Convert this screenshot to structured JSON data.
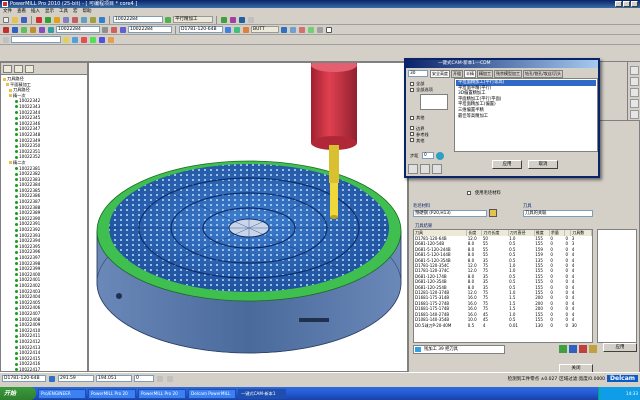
{
  "window": {
    "title": "PowerMILL Pro 2010 (25-bit) - [ 可编程项目 * core4 ]"
  },
  "menu": [
    "文件",
    "查看",
    "插入",
    "显示",
    "工具",
    "宏",
    "帮助"
  ],
  "toolbar": {
    "toolpath_select": "10022284",
    "strategy_label": "平行精加工",
    "tool_select": "10022284",
    "tool2_select": "10022284",
    "tool3_select": "D1781-120-64B",
    "boundary_label": "BUTT"
  },
  "explorer": {
    "items": [
      "刀具路径",
      "平面精加工",
      "刀具路径",
      "精一次",
      "10022342",
      "10022343",
      "10022344",
      "10022345",
      "10022346",
      "10022347",
      "10022348",
      "10022349",
      "10022350",
      "10022351",
      "10022352",
      "精二次",
      "10022381",
      "10022382",
      "10022383",
      "10022384",
      "10022385",
      "10022386",
      "10022387",
      "10022388",
      "10022389",
      "10022390",
      "10022391",
      "10022392",
      "10022393",
      "10022394",
      "10022395",
      "10022396",
      "10022397",
      "10022398",
      "10022399",
      "10022400",
      "10022401",
      "10022402",
      "10022403",
      "10022404",
      "10022405",
      "10022406",
      "10022407",
      "10022408",
      "10022409",
      "10022410",
      "10022411",
      "10022412",
      "10022413",
      "10022414",
      "10022415",
      "10022416",
      "10022417",
      "10022418",
      "10022419",
      "10022420",
      "10022421",
      "10022422"
    ]
  },
  "popup": {
    "title": "一键式CAM-新本1---CDM",
    "tabs": [
      "安全高度",
      "开粗",
      "半精",
      "精加工",
      "残余模型加工",
      "钻孔/铣孔/攻丝/沉头"
    ],
    "field_value": "30",
    "list": [
      "平坦面精加工(平行等高)",
      "平坦面半精(平行)",
      "3D偏置精加工",
      "平面精加工(平行/平面)",
      "平坦面精加工(偏置)",
      "三维偏置半精",
      "最佳等高精加工"
    ],
    "checks": [
      "全部",
      "全部选项",
      "其他"
    ],
    "options": [
      "边界",
      "参考线",
      "其他"
    ],
    "spin_label": "步距",
    "spin_value": "0",
    "btn_apply": "应用",
    "btn_cancel": "取消"
  },
  "dialog": {
    "cb_label": "使用毛坯材料",
    "material_label": "毛坯材料",
    "material_value": "预硬钢 (P20,H13)",
    "tool_label": "刀具",
    "tool_value": "刀具的关联",
    "table_title": "刀具结果",
    "columns": [
      "刀具",
      "长度",
      "刀刃长度",
      "刀刃直径",
      "锥度",
      "余量",
      "",
      "刀具数"
    ],
    "rows": [
      [
        "D1781-120-64B",
        "12.0",
        "50",
        "1.0",
        "155",
        "0",
        "0",
        "3"
      ],
      [
        "D681-120-54B",
        "8.0",
        "55",
        "0.5",
        "155",
        "0",
        "0",
        "3"
      ],
      [
        "D681-5-120-244B",
        "8.0",
        "55",
        "0.5",
        "159",
        "0",
        "0",
        "4"
      ],
      [
        "D681-5-120-144B",
        "8.0",
        "55",
        "0.5",
        "159",
        "0",
        "0",
        "4"
      ],
      [
        "D681-5-120-354B",
        "8.0",
        "35",
        "0.5",
        "135",
        "0",
        "0",
        "4"
      ],
      [
        "D1781-120-354C",
        "12.0",
        "75",
        "1.0",
        "155",
        "0",
        "0",
        "4"
      ],
      [
        "D1781-120-374C",
        "12.0",
        "75",
        "1.0",
        "155",
        "0",
        "0",
        "4"
      ],
      [
        "D681-120-174B",
        "8.0",
        "35",
        "0.5",
        "155",
        "0",
        "0",
        "4"
      ],
      [
        "D681-120-354B",
        "8.0",
        "35",
        "0.5",
        "155",
        "0",
        "0",
        "4"
      ],
      [
        "D681-120-254B",
        "8.0",
        "35",
        "0.5",
        "155",
        "0",
        "0",
        "4"
      ],
      [
        "D1281-120-374B",
        "12.0",
        "75",
        "1.0",
        "155",
        "0",
        "0",
        "4"
      ],
      [
        "D1681-175-314B",
        "16.0",
        "75",
        "1.5",
        "200",
        "0",
        "0",
        "4"
      ],
      [
        "D1681-175-274B",
        "16.0",
        "75",
        "1.5",
        "200",
        "0",
        "0",
        "4"
      ],
      [
        "D1681-175-174B",
        "16.0",
        "75",
        "1.5",
        "200",
        "0",
        "0",
        "4"
      ],
      [
        "D1681-140-274B",
        "16.0",
        "45",
        "1.0",
        "155",
        "0",
        "0",
        "4"
      ],
      [
        "D1081-140-354B",
        "10.0",
        "45",
        "0.5",
        "155",
        "0",
        "0",
        "4"
      ],
      [
        "D0.5球刀P-20-40M",
        "0.5",
        "4",
        "0.01",
        "130",
        "0",
        "0",
        "30"
      ]
    ],
    "footer_note": "残加工 39 把刀具",
    "btn_ok": "关闭",
    "btn_apply": "应用",
    "btn_close": "关闭"
  },
  "status": {
    "tool": "D1781-120-64B",
    "x": "291.59",
    "y": "194.051",
    "z": "0",
    "extra": "检测到工件零点 ±0.027",
    "extra2": "区域过滤:宽度/0.0000",
    "brand": "Delcam"
  },
  "taskbar": {
    "start": "开始",
    "tasks": [
      "Pro/ENGINEER",
      "PowerMILL Pro 20",
      "PowerMILL Pro 20",
      "Delcam PowerMILL",
      "一键式CAM-新本1"
    ],
    "clock": "14:33"
  }
}
